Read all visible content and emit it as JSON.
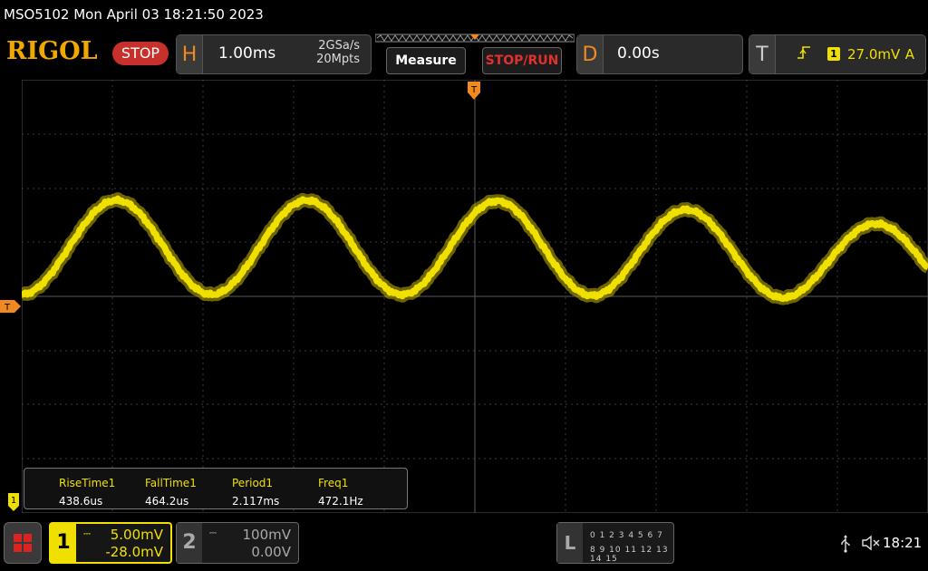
{
  "titlebar": {
    "text": "MSO5102  Mon April 03 18:21:50 2023"
  },
  "header": {
    "brand": "RIGOL",
    "status": "STOP",
    "horizontal": {
      "key": "H",
      "timebase": "1.00ms",
      "sample_rate": "2GSa/s",
      "memory_depth": "20Mpts"
    },
    "measure_label": "Measure",
    "stop_run_label": "STOP/RUN",
    "delay": {
      "key": "D",
      "value": "0.00s"
    },
    "trigger": {
      "key": "T",
      "source": "1",
      "level": "27.0mV",
      "mode": "A",
      "edge_icon": "rising-edge-icon"
    }
  },
  "screen": {
    "trigger_marker": "T",
    "channel_marker": "1",
    "grid_divisions": {
      "horizontal": 10,
      "vertical": 8
    },
    "trace_color": "#f0e000"
  },
  "measurements": [
    {
      "name": "RiseTime1",
      "value": "438.6us"
    },
    {
      "name": "FallTime1",
      "value": "464.2us"
    },
    {
      "name": "Period1",
      "value": "2.117ms"
    },
    {
      "name": "Freq1",
      "value": "472.1Hz"
    }
  ],
  "channels": {
    "ch1": {
      "number": "1",
      "coupling": "⎓",
      "scale": "5.00mV",
      "offset": "-28.0mV",
      "color": "#f0e000"
    },
    "ch2": {
      "number": "2",
      "coupling": "⎓",
      "scale": "100mV",
      "offset": "0.00V",
      "color": "#aaaaaa"
    }
  },
  "logic": {
    "key": "L",
    "row1": "0 1 2 3  4 5 6 7",
    "row2": "8 9 10 11 12 13 14 15"
  },
  "statusbar": {
    "usb_icon": "usb-icon",
    "sound_icon": "mute-icon",
    "time": "18:21"
  }
}
